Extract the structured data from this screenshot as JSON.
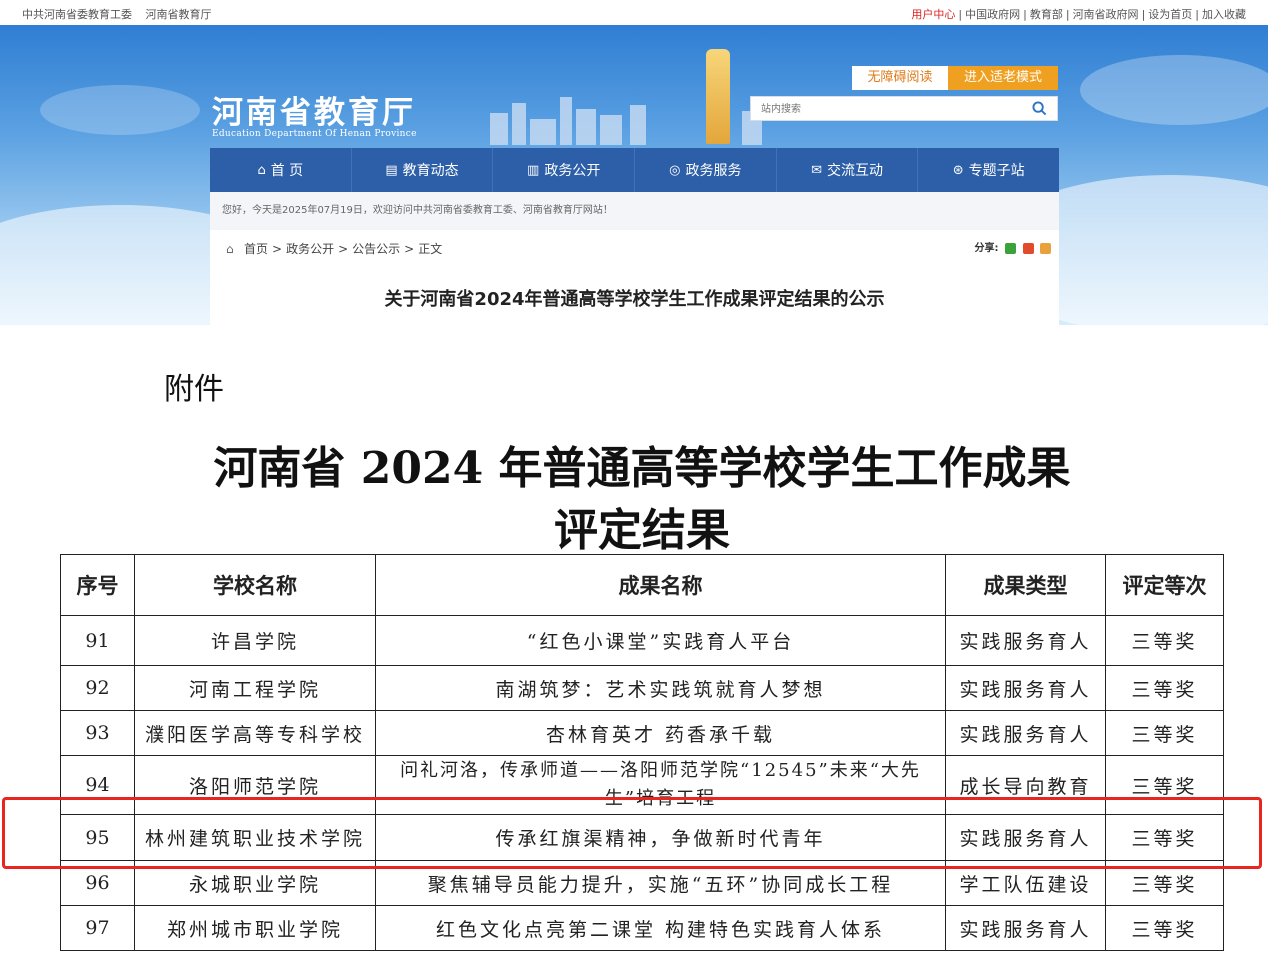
{
  "topbar": {
    "left": [
      "中共河南省委教育工委",
      "河南省教育厅"
    ],
    "right": [
      "用户中心",
      "中国政府网",
      "教育部",
      "河南省政府网",
      "设为首页",
      "加入收藏"
    ]
  },
  "header": {
    "logo_cn": "河南省教育厅",
    "logo_en": "Education Department Of Henan Province",
    "accessible_read": "无障碍阅读",
    "elder_mode": "进入适老模式",
    "search_placeholder": "站内搜索"
  },
  "nav": [
    {
      "label": "首 页",
      "icon": "home-icon"
    },
    {
      "label": "教育动态",
      "icon": "news-icon"
    },
    {
      "label": "政务公开",
      "icon": "document-icon"
    },
    {
      "label": "政务服务",
      "icon": "service-icon"
    },
    {
      "label": "交流互动",
      "icon": "chat-icon"
    },
    {
      "label": "专题子站",
      "icon": "subsite-icon"
    }
  ],
  "welcome": "您好，今天是2025年07月19日，欢迎访问中共河南省委教育工委、河南省教育厅网站！",
  "breadcrumb": [
    "首页",
    "政务公开",
    "公告公示",
    "正文"
  ],
  "share_label": "分享:",
  "article_title": "关于河南省2024年普通高等学校学生工作成果评定结果的公示",
  "document": {
    "attachment": "附件",
    "title_line1": "河南省 2024 年普通高等学校学生工作成果",
    "title_line2": "评定结果"
  },
  "table": {
    "headers": [
      "序号",
      "学校名称",
      "成果名称",
      "成果类型",
      "评定等次"
    ],
    "rows": [
      {
        "no": "91",
        "school": "许昌学院",
        "name": "“红色小课堂”实践育人平台",
        "type": "实践服务育人",
        "rank": "三等奖"
      },
      {
        "no": "92",
        "school": "河南工程学院",
        "name": "南湖筑梦：艺术实践筑就育人梦想",
        "type": "实践服务育人",
        "rank": "三等奖"
      },
      {
        "no": "93",
        "school": "濮阳医学高等专科学校",
        "name": "杏林育英才 药香承千载",
        "type": "实践服务育人",
        "rank": "三等奖"
      },
      {
        "no": "94",
        "school": "洛阳师范学院",
        "name": "问礼河洛，传承师道——洛阳师范学院“12545”未来“大先生”培育工程",
        "type": "成长导向教育",
        "rank": "三等奖"
      },
      {
        "no": "95",
        "school": "林州建筑职业技术学院",
        "name": "传承红旗渠精神，争做新时代青年",
        "type": "实践服务育人",
        "rank": "三等奖"
      },
      {
        "no": "96",
        "school": "永城职业学院",
        "name": "聚焦辅导员能力提升，实施“五环”协同成长工程",
        "type": "学工队伍建设",
        "rank": "三等奖"
      },
      {
        "no": "97",
        "school": "郑州城市职业学院",
        "name": "红色文化点亮第二课堂 构建特色实践育人体系",
        "type": "实践服务育人",
        "rank": "三等奖"
      }
    ]
  },
  "colors": {
    "nav_bg": "#2c5fa8",
    "highlight": "#e8251f",
    "elder_mode_bg": "#f0a021"
  }
}
